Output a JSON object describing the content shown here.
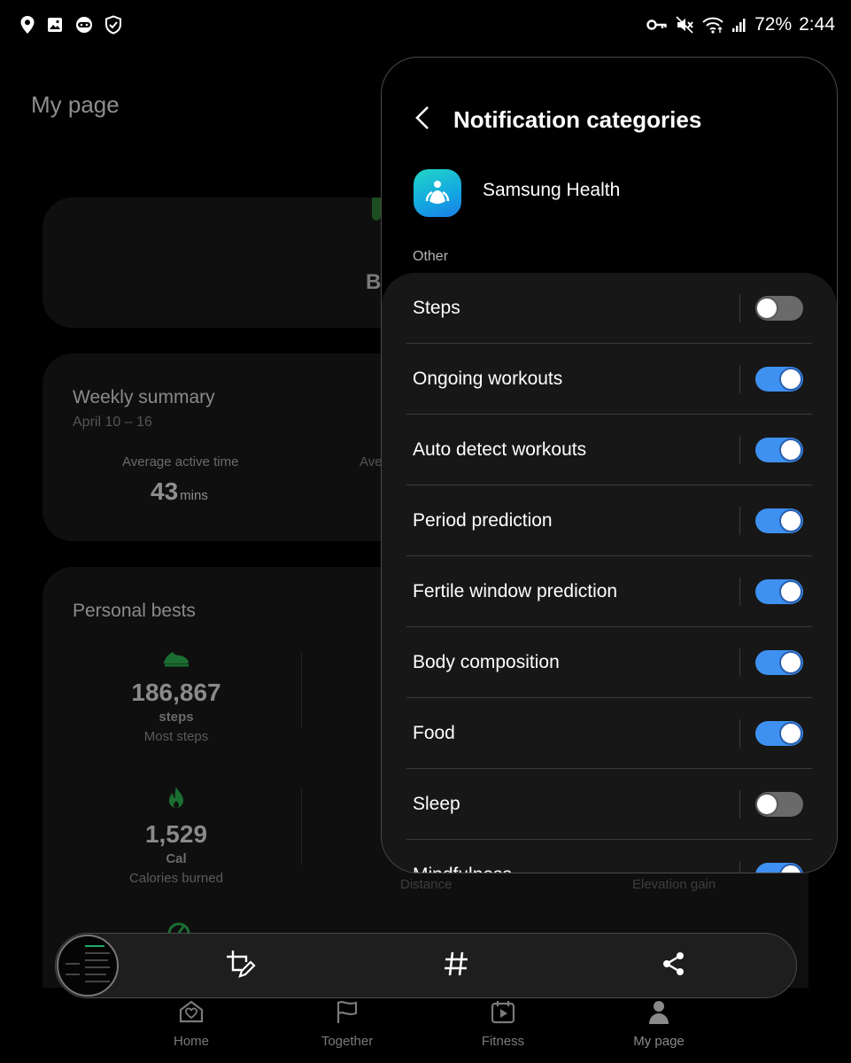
{
  "status_bar": {
    "battery": "72%",
    "time": "2:44",
    "left_icons": [
      "location-icon",
      "gallery-icon",
      "game-launcher-icon",
      "shield-icon"
    ],
    "right_icons": [
      "vpn-key-icon",
      "mute-icon",
      "wifi-icon",
      "signal-icon"
    ]
  },
  "background_page": {
    "title": "My page",
    "card1_partial_text": "B",
    "weekly_summary": {
      "title": "Weekly summary",
      "date_range": "April 10 – 16",
      "metric_label": "Average active time",
      "metric_label_partial": "Ave",
      "metric_value": "43",
      "metric_unit": "mins"
    },
    "personal_bests": {
      "title": "Personal bests",
      "items": [
        {
          "icon": "shoe-icon",
          "value": "186,867",
          "unit": "steps",
          "label": "Most steps"
        },
        {
          "icon": "flame-icon",
          "value": "1,529",
          "unit": "Cal",
          "label": "Calories burned"
        }
      ],
      "ghost_labels": [
        "Distance",
        "Elevation gain"
      ]
    },
    "bottom_nav": [
      {
        "label": "Home",
        "icon": "home-heart-icon"
      },
      {
        "label": "Together",
        "icon": "flag-icon"
      },
      {
        "label": "Fitness",
        "icon": "play-calendar-icon"
      },
      {
        "label": "My page",
        "icon": "person-icon"
      }
    ]
  },
  "screenshot_toolbar": {
    "buttons": [
      "crop-edit-icon",
      "hashtag-icon",
      "share-icon"
    ]
  },
  "notification_panel": {
    "title": "Notification categories",
    "app_name": "Samsung Health",
    "section": "Other",
    "accent": "#3e91f0",
    "categories": [
      {
        "label": "Steps",
        "enabled": false
      },
      {
        "label": "Ongoing workouts",
        "enabled": true
      },
      {
        "label": "Auto detect workouts",
        "enabled": true
      },
      {
        "label": "Period prediction",
        "enabled": true
      },
      {
        "label": "Fertile window prediction",
        "enabled": true
      },
      {
        "label": "Body composition",
        "enabled": true
      },
      {
        "label": "Food",
        "enabled": true
      },
      {
        "label": "Sleep",
        "enabled": false
      },
      {
        "label": "Mindfulness",
        "enabled": true
      }
    ]
  }
}
